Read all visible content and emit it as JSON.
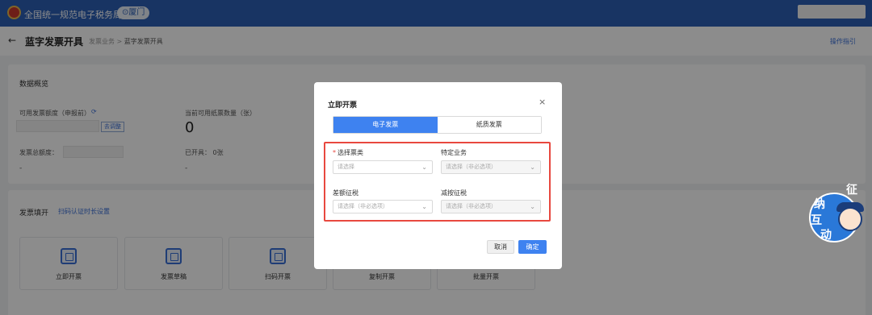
{
  "topbar": {
    "title": "全国统一规范电子税务局",
    "location": "厦门"
  },
  "page": {
    "title": "蓝字发票开具",
    "breadcrumb": {
      "parent": "发票业务",
      "separator": ">",
      "current": "蓝字发票开具"
    },
    "guide": "操作指引"
  },
  "overview": {
    "title": "数据概览",
    "available_quota_label": "可用发票额度（申报前）",
    "apply_button": "去调整",
    "paper_count_label": "当前可用纸票数量（张）",
    "paper_count_value": "0",
    "total_quota_label": "发票总额度：",
    "total_quota_dash": "-",
    "issued_label": "已开具：",
    "issued_value": "0张",
    "issued_dash": "-"
  },
  "invoice_panel": {
    "title": "发票填开",
    "scan_link": "扫码认证时长设置",
    "cards": [
      {
        "label": "立即开票",
        "icon": "invoice-icon"
      },
      {
        "label": "发票草稿",
        "icon": "draft-icon"
      },
      {
        "label": "扫码开票",
        "icon": "qrcode-icon"
      },
      {
        "label": "复制开票",
        "icon": "copy-icon"
      },
      {
        "label": "批量开票",
        "icon": "batch-icon"
      }
    ]
  },
  "modal": {
    "title": "立即开票",
    "close": "×",
    "tabs": [
      {
        "label": "电子发票",
        "active": true
      },
      {
        "label": "纸质发票",
        "active": false
      }
    ],
    "fields": {
      "invoice_type": {
        "label": "选择票类",
        "required_mark": "*",
        "placeholder": "请选择"
      },
      "special_business": {
        "label": "特定业务",
        "placeholder": "请选择（非必选项）"
      },
      "differential_tax": {
        "label": "差额征税",
        "placeholder": "请选择（非必选项）"
      },
      "reduced_tax": {
        "label": "减按征税",
        "placeholder": "请选择（非必选项）"
      }
    },
    "cancel": "取消",
    "confirm": "确定"
  },
  "mascot": {
    "chars": [
      "征",
      "纳",
      "互",
      "动"
    ]
  },
  "colors": {
    "primary": "#3e82f0",
    "highlight": "#e8483f",
    "topbar": "#2d5fb4"
  }
}
